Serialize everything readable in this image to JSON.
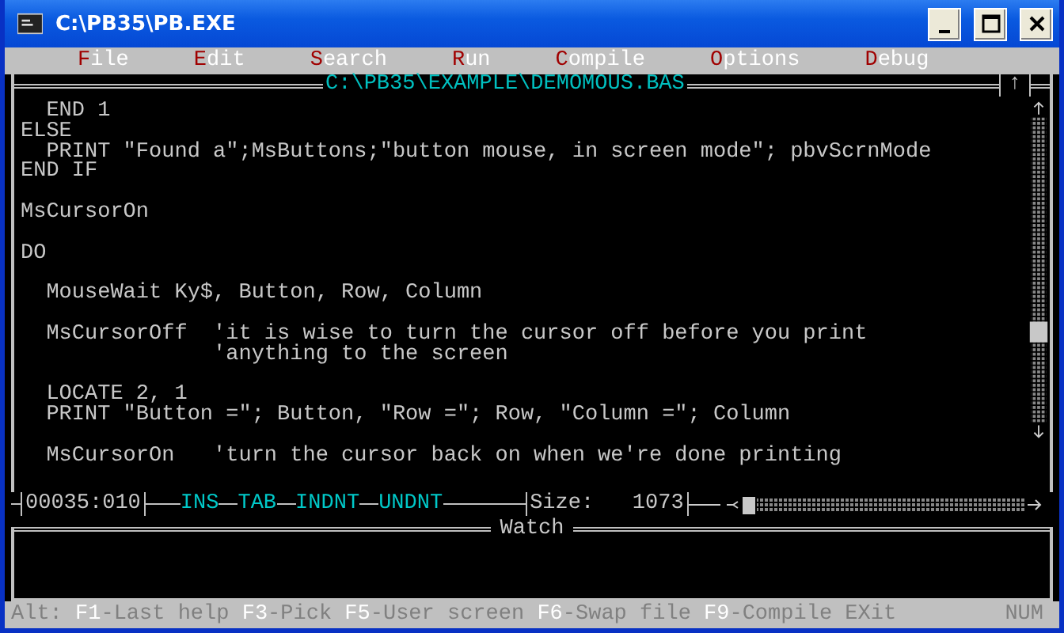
{
  "window": {
    "title": "C:\\PB35\\PB.EXE"
  },
  "menu": [
    {
      "label": "File"
    },
    {
      "label": "Edit"
    },
    {
      "label": "Search"
    },
    {
      "label": "Run"
    },
    {
      "label": "Compile"
    },
    {
      "label": "Options"
    },
    {
      "label": "Debug"
    }
  ],
  "editor": {
    "title": "C:\\PB35\\EXAMPLE\\DEMOMOUS.BAS",
    "zoom_button": "↑",
    "lines": [
      {
        "text": "  END 1",
        "gap_before": false
      },
      {
        "text": "ELSE",
        "gap_before": false
      },
      {
        "text": "  PRINT \"Found a\";MsButtons;\"button mouse, in screen mode\"; pbvScrnMode",
        "gap_before": false
      },
      {
        "text": "END IF",
        "gap_before": false
      },
      {
        "text": "MsCursorOn",
        "gap_before": true
      },
      {
        "text": "DO",
        "gap_before": true
      },
      {
        "text": "  MouseWait Ky$, Button, Row, Column",
        "gap_before": true
      },
      {
        "text": "  MsCursorOff  'it is wise to turn the cursor off before you print",
        "gap_before": true
      },
      {
        "text": "               'anything to the screen",
        "gap_before": false
      },
      {
        "text": "  LOCATE 2, 1",
        "gap_before": true
      },
      {
        "text": "  PRINT \"Button =\"; Button, \"Row =\"; Row, \"Column =\"; Column",
        "gap_before": false
      },
      {
        "text": "  MsCursorOn   'turn the cursor back on when we're done printing",
        "gap_before": true
      }
    ]
  },
  "status": {
    "position": "00035:010",
    "flags": [
      "INS",
      "TAB",
      "INDNT",
      "UNDNT"
    ],
    "size_label": "Size:",
    "size_value": "1073"
  },
  "watch": {
    "title": "Watch"
  },
  "help": {
    "prefix": "Alt:",
    "items": [
      {
        "key": "F1",
        "text": "-Last help"
      },
      {
        "key": "F3",
        "text": "-Pick"
      },
      {
        "key": "F5",
        "text": "-User screen"
      },
      {
        "key": "F6",
        "text": "-Swap file"
      },
      {
        "key": "F9",
        "text": "-Compile EXit"
      }
    ],
    "indicator": "NUM"
  }
}
